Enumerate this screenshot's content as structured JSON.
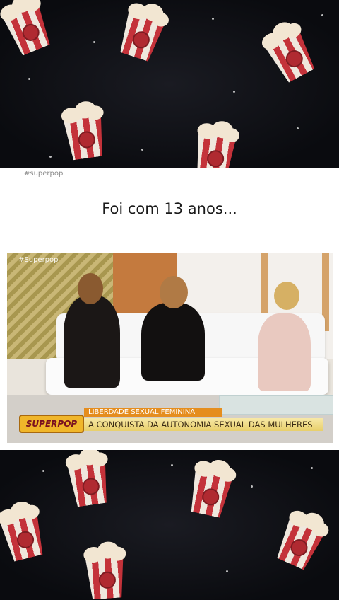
{
  "post": {
    "hashtag": "#superpop",
    "caption": "Foi com 13 anos..."
  },
  "video": {
    "corner_tag": "#Superpop",
    "logo": "SUPERPOP",
    "headline": "LIBERDADE SEXUAL FEMININA",
    "subtitle": "A CONQUISTA DA AUTONOMIA SEXUAL DAS MULHERES"
  },
  "colors": {
    "background": "#0d0e12",
    "panel": "#ffffff",
    "popcorn_red": "#c4323a",
    "headline_orange": "#e58d1e",
    "bar_gold": "#e8cf6b"
  },
  "icons": [
    "popcorn-icon"
  ]
}
